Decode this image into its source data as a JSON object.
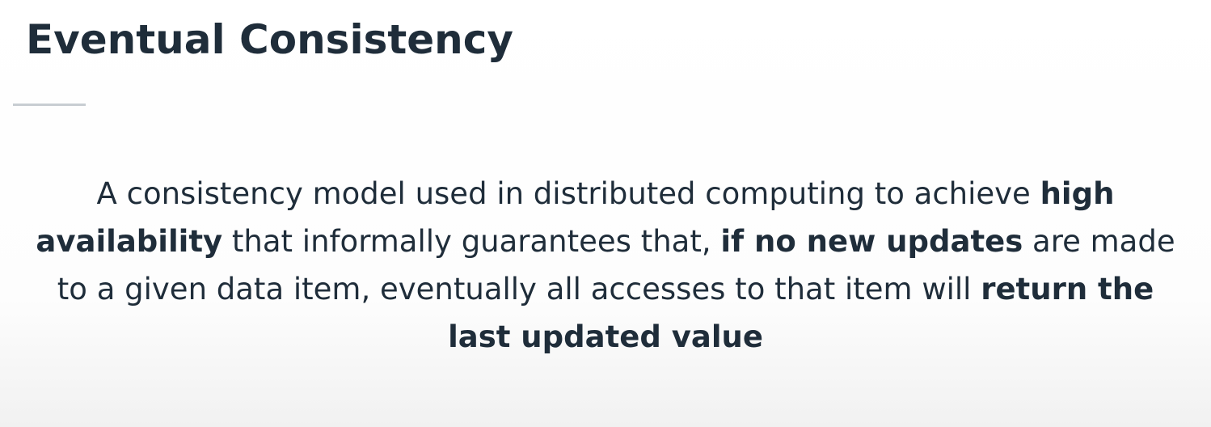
{
  "slide": {
    "title": "Eventual Consistency",
    "definition": {
      "part1": "A consistency model used in distributed computing to achieve ",
      "bold1": "high availability",
      "part2": " that informally guarantees that, ",
      "bold2": "if no new updates",
      "part3": " are made to a given data item, eventually all accesses to that item will ",
      "bold3": "return the last updated value"
    }
  },
  "colors": {
    "text": "#1f2d3a",
    "divider": "#c8cdd2"
  }
}
